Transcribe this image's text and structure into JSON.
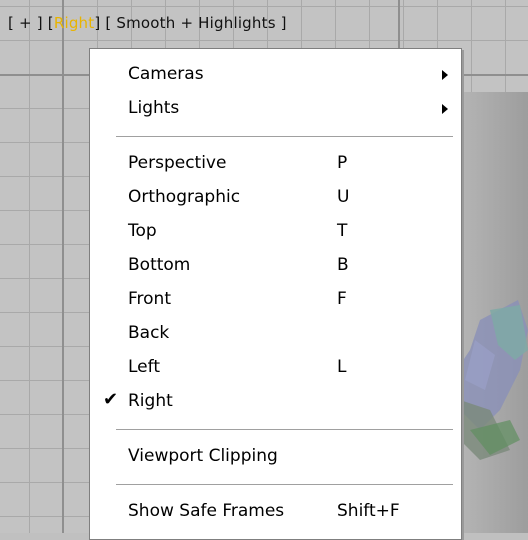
{
  "viewport": {
    "label_parts": [
      "[ + ]",
      "[",
      "Right",
      "]",
      "[ Smooth + Highlights ]"
    ],
    "active_view": "Right"
  },
  "menu": {
    "items": [
      {
        "label": "Cameras",
        "shortcut": "",
        "submenu": true,
        "checked": false
      },
      {
        "label": "Lights",
        "shortcut": "",
        "submenu": true,
        "checked": false
      },
      {
        "label": "Perspective",
        "shortcut": "P",
        "submenu": false,
        "checked": false
      },
      {
        "label": "Orthographic",
        "shortcut": "U",
        "submenu": false,
        "checked": false
      },
      {
        "label": "Top",
        "shortcut": "T",
        "submenu": false,
        "checked": false
      },
      {
        "label": "Bottom",
        "shortcut": "B",
        "submenu": false,
        "checked": false
      },
      {
        "label": "Front",
        "shortcut": "F",
        "submenu": false,
        "checked": false
      },
      {
        "label": "Back",
        "shortcut": "",
        "submenu": false,
        "checked": false
      },
      {
        "label": "Left",
        "shortcut": "L",
        "submenu": false,
        "checked": false
      },
      {
        "label": "Right",
        "shortcut": "",
        "submenu": false,
        "checked": true
      },
      {
        "label": "Viewport Clipping",
        "shortcut": "",
        "submenu": false,
        "checked": false
      },
      {
        "label": "Show Safe Frames",
        "shortcut": "Shift+F",
        "submenu": false,
        "checked": false
      }
    ],
    "check_glyph": "✔"
  },
  "colors": {
    "active_label": "#e8b400",
    "viewport_bg": "#c3c3c3",
    "menu_bg": "#ffffff"
  }
}
